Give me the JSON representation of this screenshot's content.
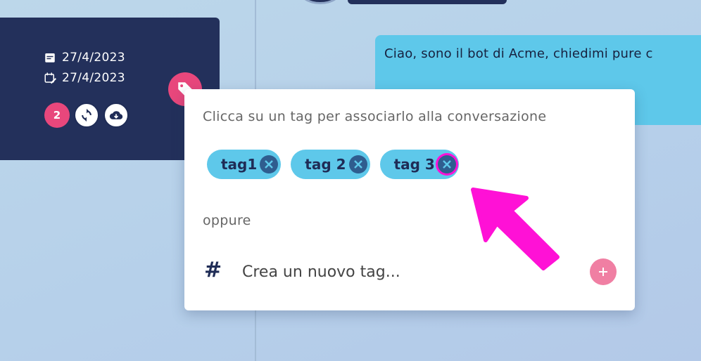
{
  "conversation": {
    "created_date": "27/4/2023",
    "updated_date": "27/4/2023",
    "count_badge": "2"
  },
  "bot_message": {
    "text": "Ciao, sono il bot di Acme, chiedimi pure c"
  },
  "tag_popup": {
    "title": "Clicca su un tag per associarlo alla conversazione",
    "tags": [
      "tag1",
      "tag 2",
      "tag 3"
    ],
    "or_label": "oppure",
    "hash_symbol": "#",
    "new_tag_placeholder": "Crea un nuovo tag..."
  },
  "colors": {
    "navy": "#23305b",
    "accent_pink": "#e8477c",
    "chip_blue": "#5ec8ea",
    "highlight_magenta": "#ff11d6"
  }
}
